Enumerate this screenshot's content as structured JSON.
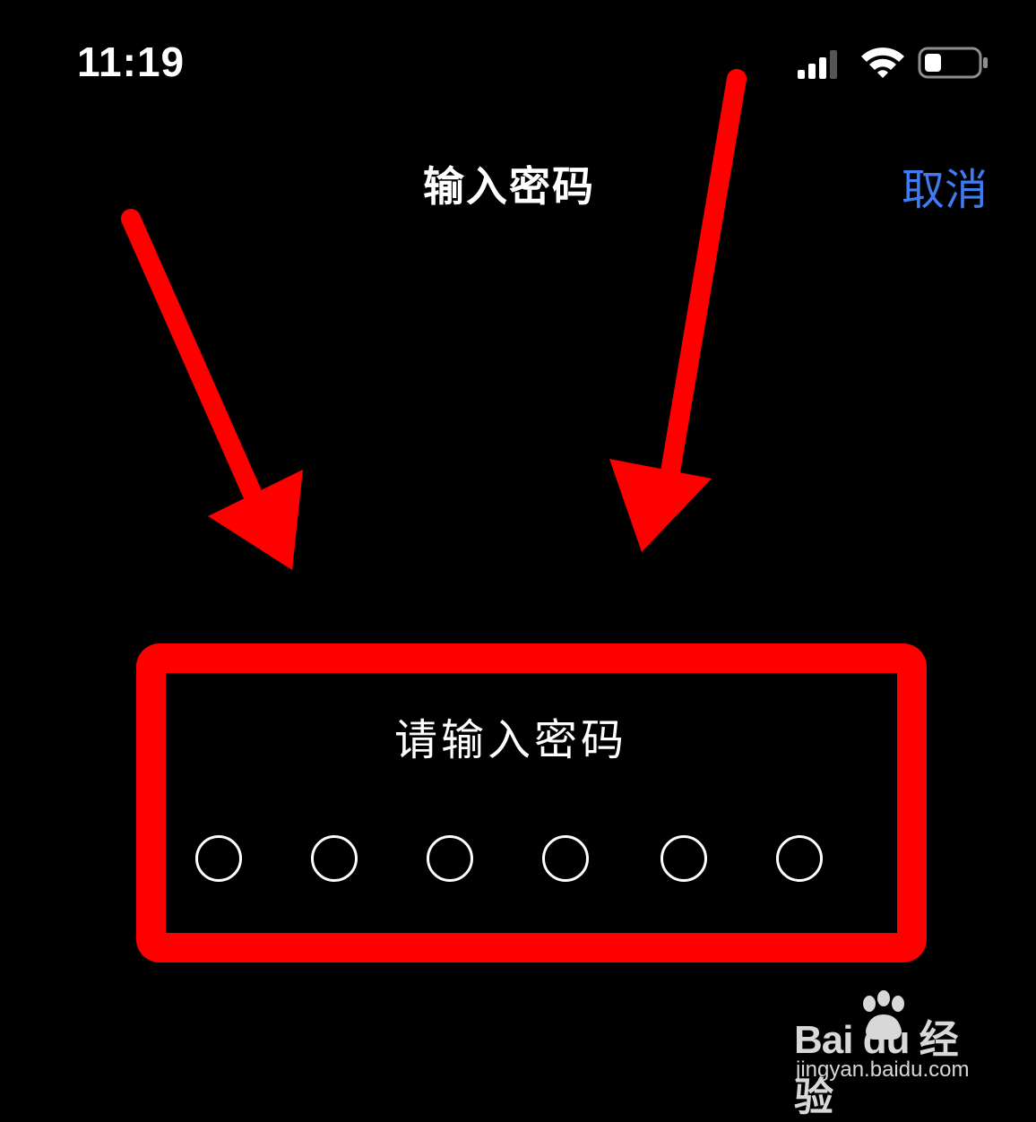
{
  "status_bar": {
    "time": "11:19",
    "icons": [
      "cellular-signal-icon",
      "wifi-icon",
      "battery-icon"
    ]
  },
  "nav": {
    "title": "输入密码",
    "cancel_label": "取消"
  },
  "passcode": {
    "prompt": "请输入密码",
    "digit_count": 6,
    "filled_count": 0
  },
  "annotation": {
    "arrow_color": "#ff0000",
    "box_color": "#ff0000"
  },
  "watermark": {
    "logo_text": "Bai du 经验",
    "url": "jingyan.baidu.com"
  },
  "colors": {
    "background": "#000000",
    "accent": "#3f7cf4",
    "text": "#ffffff"
  }
}
